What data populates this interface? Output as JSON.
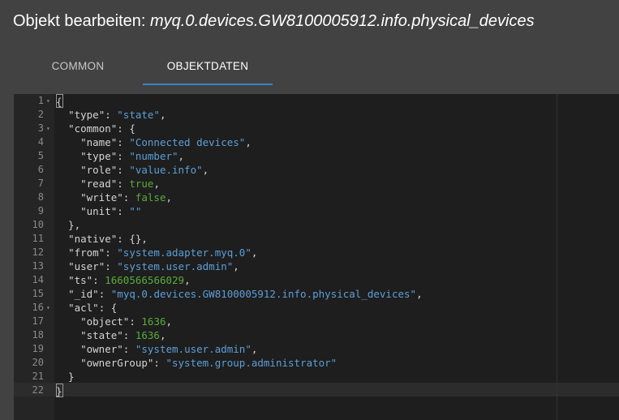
{
  "title": {
    "prefix": "Objekt bearbeiten: ",
    "object_id": "myq.0.devices.GW8100005912.info.physical_devices"
  },
  "tabs": [
    {
      "label": "COMMON",
      "active": false
    },
    {
      "label": "OBJEKTDATEN",
      "active": true
    }
  ],
  "colors": {
    "accent": "#3f83c3",
    "string": "#5c9fd8",
    "number": "#5aab3c",
    "background": "#424242",
    "editor_background": "#1e1e1e"
  },
  "editor": {
    "lines": [
      {
        "n": "1",
        "fold": true,
        "tokens": [
          [
            "cursor",
            ""
          ],
          [
            "p",
            "{"
          ]
        ]
      },
      {
        "n": "2",
        "tokens": [
          [
            "p",
            "  "
          ],
          [
            "k",
            "\"type\""
          ],
          [
            "p",
            ": "
          ],
          [
            "s",
            "\"state\""
          ],
          [
            "p",
            ","
          ]
        ]
      },
      {
        "n": "3",
        "fold": true,
        "tokens": [
          [
            "p",
            "  "
          ],
          [
            "k",
            "\"common\""
          ],
          [
            "p",
            ": {"
          ]
        ]
      },
      {
        "n": "4",
        "tokens": [
          [
            "p",
            "    "
          ],
          [
            "k",
            "\"name\""
          ],
          [
            "p",
            ": "
          ],
          [
            "s",
            "\"Connected devices\""
          ],
          [
            "p",
            ","
          ]
        ]
      },
      {
        "n": "5",
        "tokens": [
          [
            "p",
            "    "
          ],
          [
            "k",
            "\"type\""
          ],
          [
            "p",
            ": "
          ],
          [
            "s",
            "\"number\""
          ],
          [
            "p",
            ","
          ]
        ]
      },
      {
        "n": "6",
        "tokens": [
          [
            "p",
            "    "
          ],
          [
            "k",
            "\"role\""
          ],
          [
            "p",
            ": "
          ],
          [
            "s",
            "\"value.info\""
          ],
          [
            "p",
            ","
          ]
        ]
      },
      {
        "n": "7",
        "tokens": [
          [
            "p",
            "    "
          ],
          [
            "k",
            "\"read\""
          ],
          [
            "p",
            ": "
          ],
          [
            "b",
            "true"
          ],
          [
            "p",
            ","
          ]
        ]
      },
      {
        "n": "8",
        "tokens": [
          [
            "p",
            "    "
          ],
          [
            "k",
            "\"write\""
          ],
          [
            "p",
            ": "
          ],
          [
            "b",
            "false"
          ],
          [
            "p",
            ","
          ]
        ]
      },
      {
        "n": "9",
        "tokens": [
          [
            "p",
            "    "
          ],
          [
            "k",
            "\"unit\""
          ],
          [
            "p",
            ": "
          ],
          [
            "s",
            "\"\""
          ]
        ]
      },
      {
        "n": "10",
        "tokens": [
          [
            "p",
            "  },"
          ]
        ]
      },
      {
        "n": "11",
        "tokens": [
          [
            "p",
            "  "
          ],
          [
            "k",
            "\"native\""
          ],
          [
            "p",
            ": {},"
          ]
        ]
      },
      {
        "n": "12",
        "tokens": [
          [
            "p",
            "  "
          ],
          [
            "k",
            "\"from\""
          ],
          [
            "p",
            ": "
          ],
          [
            "s",
            "\"system.adapter.myq.0\""
          ],
          [
            "p",
            ","
          ]
        ]
      },
      {
        "n": "13",
        "tokens": [
          [
            "p",
            "  "
          ],
          [
            "k",
            "\"user\""
          ],
          [
            "p",
            ": "
          ],
          [
            "s",
            "\"system.user.admin\""
          ],
          [
            "p",
            ","
          ]
        ]
      },
      {
        "n": "14",
        "tokens": [
          [
            "p",
            "  "
          ],
          [
            "k",
            "\"ts\""
          ],
          [
            "p",
            ": "
          ],
          [
            "n",
            "1660566566029"
          ],
          [
            "p",
            ","
          ]
        ]
      },
      {
        "n": "15",
        "tokens": [
          [
            "p",
            "  "
          ],
          [
            "k",
            "\"_id\""
          ],
          [
            "p",
            ": "
          ],
          [
            "s",
            "\"myq.0.devices.GW8100005912.info.physical_devices\""
          ],
          [
            "p",
            ","
          ]
        ]
      },
      {
        "n": "16",
        "fold": true,
        "tokens": [
          [
            "p",
            "  "
          ],
          [
            "k",
            "\"acl\""
          ],
          [
            "p",
            ": {"
          ]
        ]
      },
      {
        "n": "17",
        "tokens": [
          [
            "p",
            "    "
          ],
          [
            "k",
            "\"object\""
          ],
          [
            "p",
            ": "
          ],
          [
            "n",
            "1636"
          ],
          [
            "p",
            ","
          ]
        ]
      },
      {
        "n": "18",
        "tokens": [
          [
            "p",
            "    "
          ],
          [
            "k",
            "\"state\""
          ],
          [
            "p",
            ": "
          ],
          [
            "n",
            "1636"
          ],
          [
            "p",
            ","
          ]
        ]
      },
      {
        "n": "19",
        "tokens": [
          [
            "p",
            "    "
          ],
          [
            "k",
            "\"owner\""
          ],
          [
            "p",
            ": "
          ],
          [
            "s",
            "\"system.user.admin\""
          ],
          [
            "p",
            ","
          ]
        ]
      },
      {
        "n": "20",
        "tokens": [
          [
            "p",
            "    "
          ],
          [
            "k",
            "\"ownerGroup\""
          ],
          [
            "p",
            ": "
          ],
          [
            "s",
            "\"system.group.administrator\""
          ]
        ]
      },
      {
        "n": "21",
        "tokens": [
          [
            "p",
            "  }"
          ]
        ]
      },
      {
        "n": "22",
        "tokens": [
          [
            "cursor",
            ""
          ],
          [
            "p",
            "}"
          ]
        ]
      }
    ]
  }
}
